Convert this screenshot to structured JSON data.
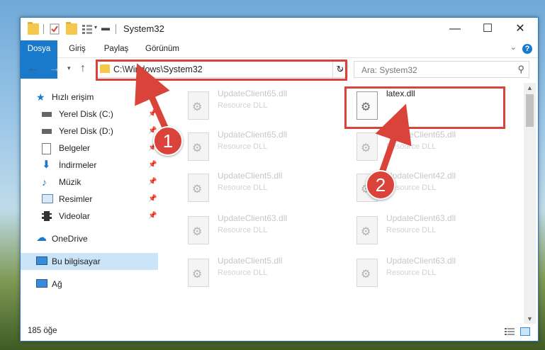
{
  "window": {
    "title": "System32",
    "controls": {
      "minimize": "—",
      "maximize": "☐",
      "close": "✕"
    }
  },
  "ribbon": {
    "tabs": [
      "Dosya",
      "Giriş",
      "Paylaş",
      "Görünüm"
    ],
    "help": "?"
  },
  "address": {
    "path": "C:\\Windows\\System32",
    "search_placeholder": "Ara: System32"
  },
  "nav": {
    "quick_access": "Hızlı erişim",
    "items": [
      {
        "label": "Yerel Disk (C:)",
        "icon": "drive-icon"
      },
      {
        "label": "Yerel Disk (D:)",
        "icon": "drive-icon"
      },
      {
        "label": "Belgeler",
        "icon": "documents-icon"
      },
      {
        "label": "İndirmeler",
        "icon": "download-icon"
      },
      {
        "label": "Müzik",
        "icon": "music-icon"
      },
      {
        "label": "Resimler",
        "icon": "pictures-icon"
      },
      {
        "label": "Videolar",
        "icon": "videos-icon"
      }
    ],
    "onedrive": "OneDrive",
    "this_pc": "Bu bilgisayar",
    "network": "Ağ"
  },
  "files": [
    {
      "name": "UpdateClient65.dll",
      "desc": "Resource DLL"
    },
    {
      "name": "latex.dll",
      "desc": ""
    },
    {
      "name": "UpdateClient65.dll",
      "desc": "Resource DLL"
    },
    {
      "name": "UpdateClient65.dll",
      "desc": "Resource DLL"
    },
    {
      "name": "UpdateClient5.dll",
      "desc": "Resource DLL"
    },
    {
      "name": "UpdateClient42.dll",
      "desc": "Resource DLL"
    },
    {
      "name": "UpdateClient63.dll",
      "desc": "Resource DLL"
    },
    {
      "name": "UpdateClient63.dll",
      "desc": "Resource DLL"
    },
    {
      "name": "UpdateClient5.dll",
      "desc": "Resource DLL"
    },
    {
      "name": "UpdateClient63.dll",
      "desc": "Resource DLL"
    }
  ],
  "status": {
    "count": "185 öğe"
  },
  "annotations": {
    "step1": "1",
    "step2": "2",
    "color": "#d9433a"
  }
}
